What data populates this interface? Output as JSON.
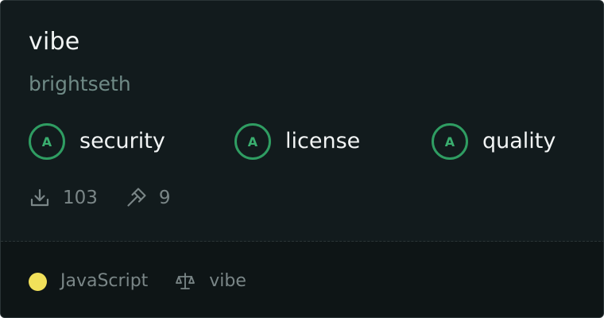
{
  "package": {
    "name": "vibe",
    "owner": "brightseth"
  },
  "scores": [
    {
      "label": "security",
      "grade": "A"
    },
    {
      "label": "license",
      "grade": "A"
    },
    {
      "label": "quality",
      "grade": "A"
    }
  ],
  "stats": {
    "downloads": "103",
    "builds": "9"
  },
  "footer": {
    "language": "JavaScript",
    "license": "vibe"
  },
  "colors": {
    "background": "#121b1d",
    "footer_background": "#0e1516",
    "grade_accent": "#2f9d62",
    "language_dot": "#f1e05a",
    "muted_text": "#7a8687"
  },
  "icons": {
    "downloads": "download-icon",
    "builds": "hammer-icon",
    "license": "scale-icon"
  }
}
